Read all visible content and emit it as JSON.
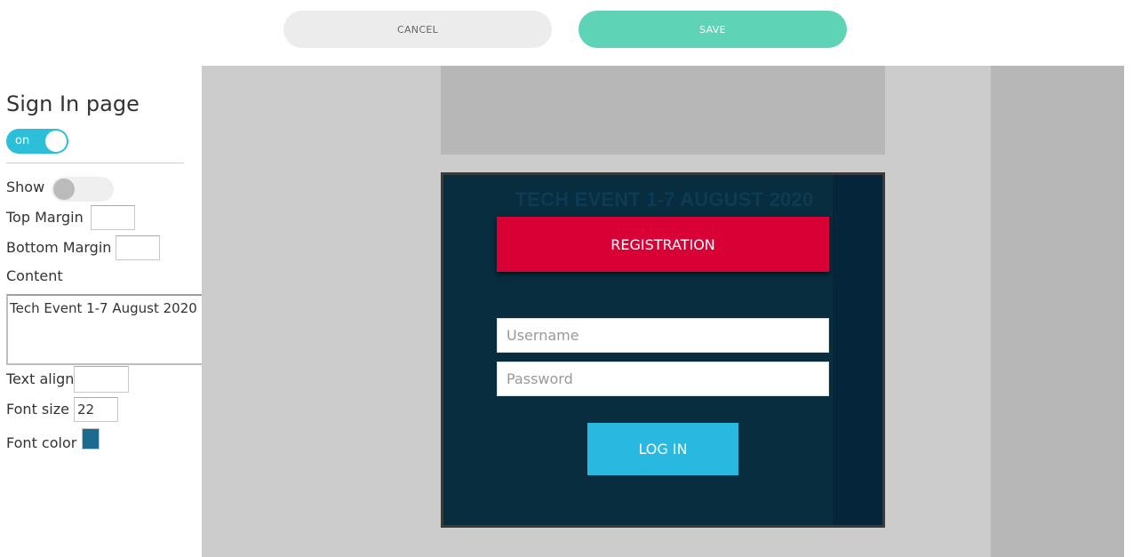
{
  "toolbar": {
    "cancel_label": "CANCEL",
    "save_label": "SAVE",
    "cancel_color": "#ececec",
    "save_color": "#5fd3b6"
  },
  "settings": {
    "title": "Sign In page",
    "page_toggle": {
      "label": "on",
      "state": "on",
      "color": "#2bbfd9"
    },
    "show": {
      "label": "Show",
      "state": "off"
    },
    "top_margin": {
      "label": "Top Margin",
      "value": ""
    },
    "bottom_margin": {
      "label": "Bottom Margin",
      "value": ""
    },
    "content": {
      "label": "Content",
      "value": "Tech Event 1-7 August 2020"
    },
    "text_align": {
      "label": "Text align",
      "value": ""
    },
    "font_size": {
      "label": "Font size",
      "value": "22"
    },
    "font_color": {
      "label": "Font color",
      "value": "#1a6b8f"
    }
  },
  "preview": {
    "event_title": "TECH EVENT 1-7 AUGUST 2020",
    "register_label": "REGISTRATION",
    "username_placeholder": "Username",
    "password_placeholder": "Password",
    "login_label": "LOG IN",
    "box_color": "#072d3f",
    "register_color": "#d80035",
    "login_color": "#29b8e0"
  }
}
